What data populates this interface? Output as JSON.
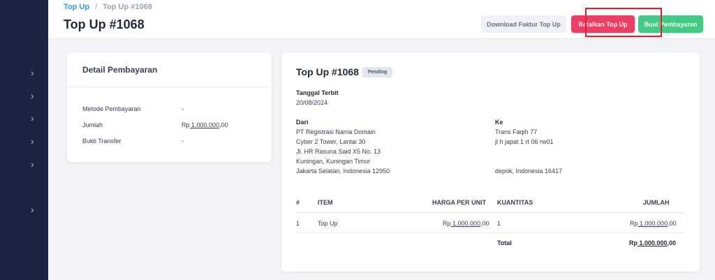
{
  "breadcrumb": {
    "parent": "Top Up",
    "separator": "/",
    "current": "Top Up #1068"
  },
  "page_title": "Top Up #1068",
  "actions": {
    "download": "Download Faktur Top Up",
    "cancel": "Batalkan Top Up",
    "pay": "Buat Pembayaran"
  },
  "payment_detail": {
    "title": "Detail Pembayaran",
    "rows": [
      {
        "label": "Metode Pembayaran",
        "value": "-"
      },
      {
        "label": "Jumlah",
        "currency": "Rp",
        "amount": "1.000.000",
        "cents": ",00"
      },
      {
        "label": "Bukti Transfer",
        "value": "-"
      }
    ]
  },
  "invoice": {
    "title": "Top Up #1068",
    "status": "Pending",
    "issue_date_label": "Tanggal Terbit",
    "issue_date": "20/08/2024",
    "from_label": "Dari",
    "from_lines": [
      "PT Registrasi Nama Domain",
      "Cyber 2 Tower, Lantai 30",
      "Jl. HR Rasuna Said X5 No. 13",
      "Kuningan, Kuningan Timur",
      "Jakarta Selatan, Indonesia 12950"
    ],
    "to_label": "Ke",
    "to_lines": [
      "Trans Faqih 77",
      "jl h japat 1 rt 06 rw01"
    ],
    "to_city": "depok, Indonesia 16417",
    "table": {
      "headers": [
        "#",
        "ITEM",
        "HARGA PER UNIT",
        "KUANTITAS",
        "JUMLAH"
      ],
      "row": {
        "no": "1",
        "item": "Top Up",
        "price_cur": "Rp",
        "price_amt": "1.000.000",
        "price_cents": ",00",
        "qty": "1",
        "total_cur": "Rp",
        "total_amt": "1.000.000",
        "total_cents": ",00"
      },
      "total_label": "Total",
      "grand": {
        "cur": "Rp",
        "amt": "1.000.000",
        "cents": ",00"
      }
    }
  },
  "sidebar": {
    "chevron_count": 7
  },
  "colors": {
    "sidebar": "#1c2442",
    "accent_blue": "#3b9bd6",
    "cancel": "#ea3f66",
    "pay": "#46c985",
    "highlight": "#e01e26"
  }
}
